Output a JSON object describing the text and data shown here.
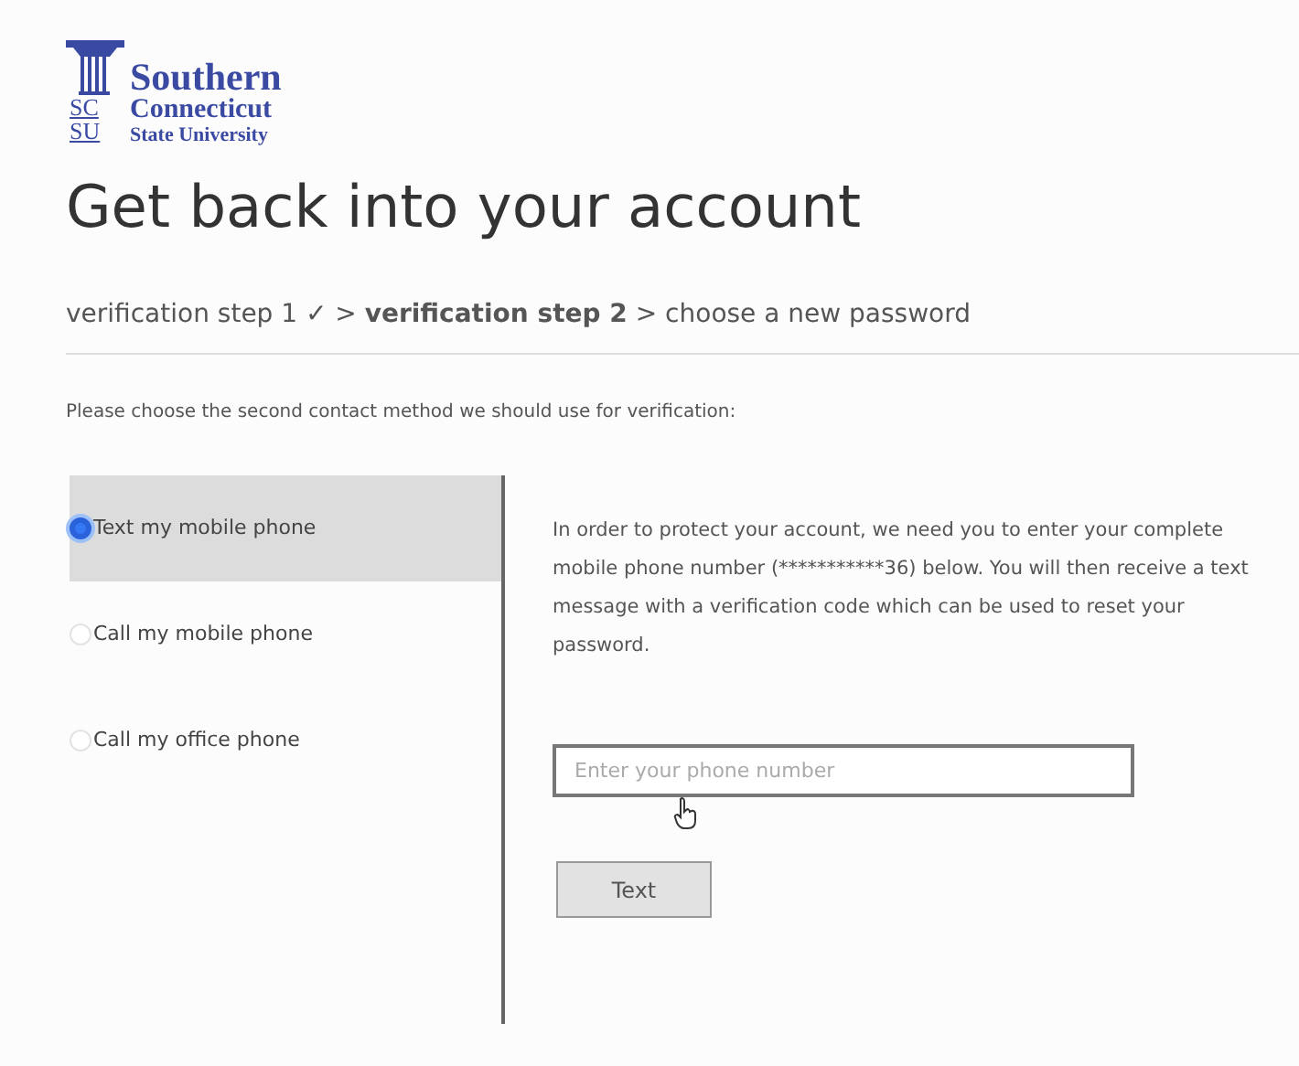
{
  "logo": {
    "initials": [
      "SC",
      "SU"
    ],
    "lines": [
      "Southern",
      "Connecticut",
      "State University"
    ]
  },
  "title": "Get back into your account",
  "steps": "verification step 1 ✓ > **verification step 2** > choose a new password",
  "instruction": "Please choose the second contact method we should use for verification:",
  "methods": [
    {
      "label": "Text my mobile phone",
      "selected": true
    },
    {
      "label": "Call my mobile phone",
      "selected": false
    },
    {
      "label": "Call my office phone",
      "selected": false
    }
  ],
  "message": "In order to protect your account, we need you to enter your complete mobile phone number (***********36) below. You will then receive a text message with a verification code which can be used to reset your password.",
  "phone_field": {
    "placeholder": "Enter your phone number"
  },
  "submit_button": "Text"
}
